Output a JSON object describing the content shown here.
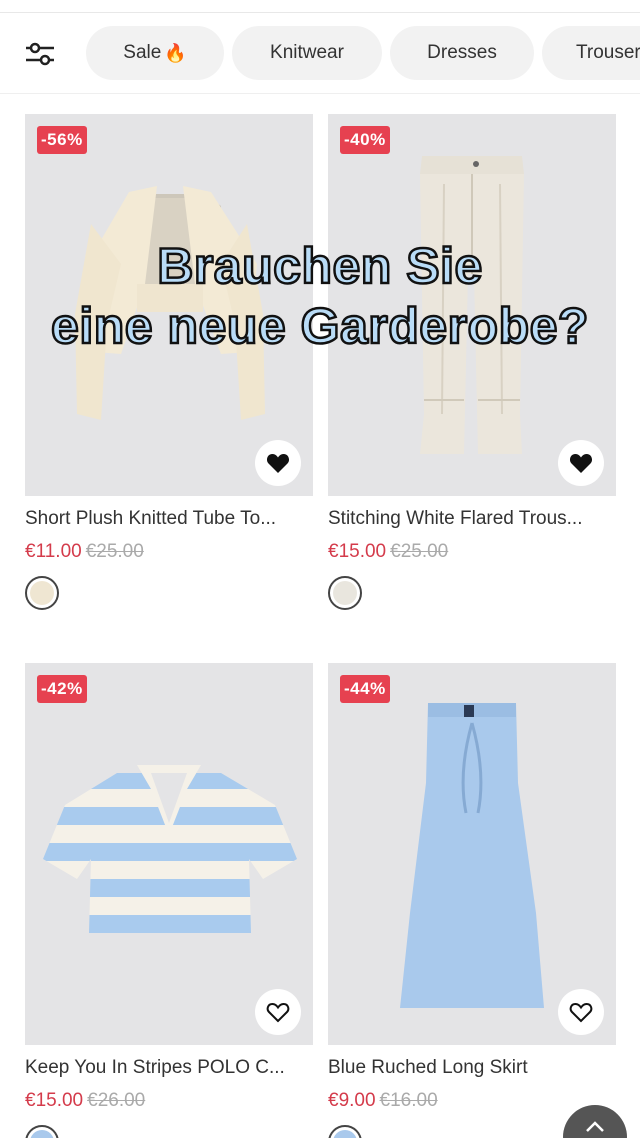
{
  "categories": [
    {
      "label": "Sale",
      "icon": "fire-icon",
      "emoji": "🔥"
    },
    {
      "label": "Knitwear"
    },
    {
      "label": "Dresses"
    },
    {
      "label": "Trousers"
    }
  ],
  "overlay": {
    "line1": "Brauchen Sie",
    "line2": "eine neue Garderobe?"
  },
  "products": [
    {
      "badge": "-56%",
      "title": "Short Plush Knitted Tube To...",
      "price": "€11.00",
      "old_price": "€25.00",
      "favorited": true,
      "swatch_color": "#efe6d2"
    },
    {
      "badge": "-40%",
      "title": "Stitching White Flared Trous...",
      "price": "€15.00",
      "old_price": "€25.00",
      "favorited": true,
      "swatch_color": "#e9e6de"
    },
    {
      "badge": "-42%",
      "title": "Keep You In Stripes POLO C...",
      "price": "€15.00",
      "old_price": "€26.00",
      "favorited": false,
      "swatch_color": "#a9c9ec"
    },
    {
      "badge": "-44%",
      "title": "Blue Ruched Long Skirt",
      "price": "€9.00",
      "old_price": "€16.00",
      "favorited": false,
      "swatch_color": "#a9c9ec"
    }
  ],
  "colors": {
    "badge": "#e64150",
    "price": "#d43b4b",
    "overlay_text": "#b9dcf7"
  }
}
